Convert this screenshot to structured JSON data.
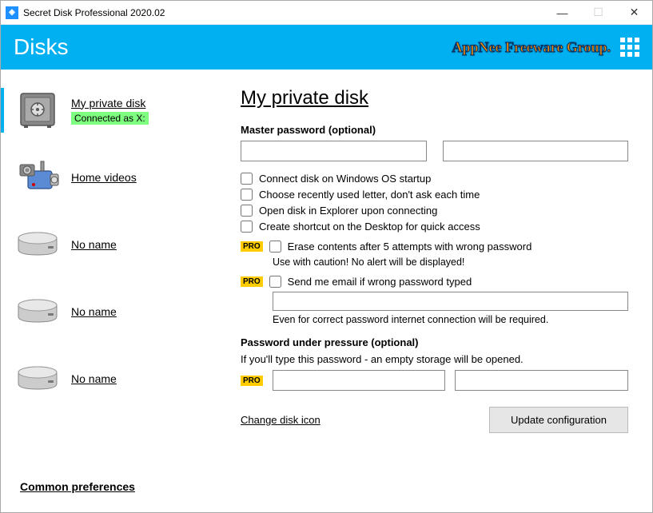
{
  "titlebar": {
    "title": "Secret Disk Professional 2020.02"
  },
  "header": {
    "title": "Disks",
    "brand": "AppNee Freeware Group."
  },
  "sidebar": {
    "items": [
      {
        "label": "My private disk",
        "status": "Connected as X:"
      },
      {
        "label": "Home videos"
      },
      {
        "label": "No name"
      },
      {
        "label": "No name"
      },
      {
        "label": "No name"
      }
    ],
    "common": "Common preferences"
  },
  "main": {
    "title": "My private disk",
    "master_label": "Master password (optional)",
    "chk_startup": "Connect disk on Windows OS startup",
    "chk_letter": "Choose recently used letter, don't ask each time",
    "chk_explorer": "Open disk in Explorer upon connecting",
    "chk_shortcut": "Create shortcut on the Desktop for quick access",
    "pro": "PRO",
    "chk_erase": "Erase contents after 5 attempts with wrong password",
    "erase_hint": "Use with caution! No alert will be displayed!",
    "chk_email": "Send me email if wrong password typed",
    "email_hint": "Even for correct password internet connection will be required.",
    "pressure_label": "Password under pressure (optional)",
    "pressure_desc": "If you'll type this password - an empty storage will be opened.",
    "change_icon": "Change disk icon",
    "update_btn": "Update configuration"
  }
}
